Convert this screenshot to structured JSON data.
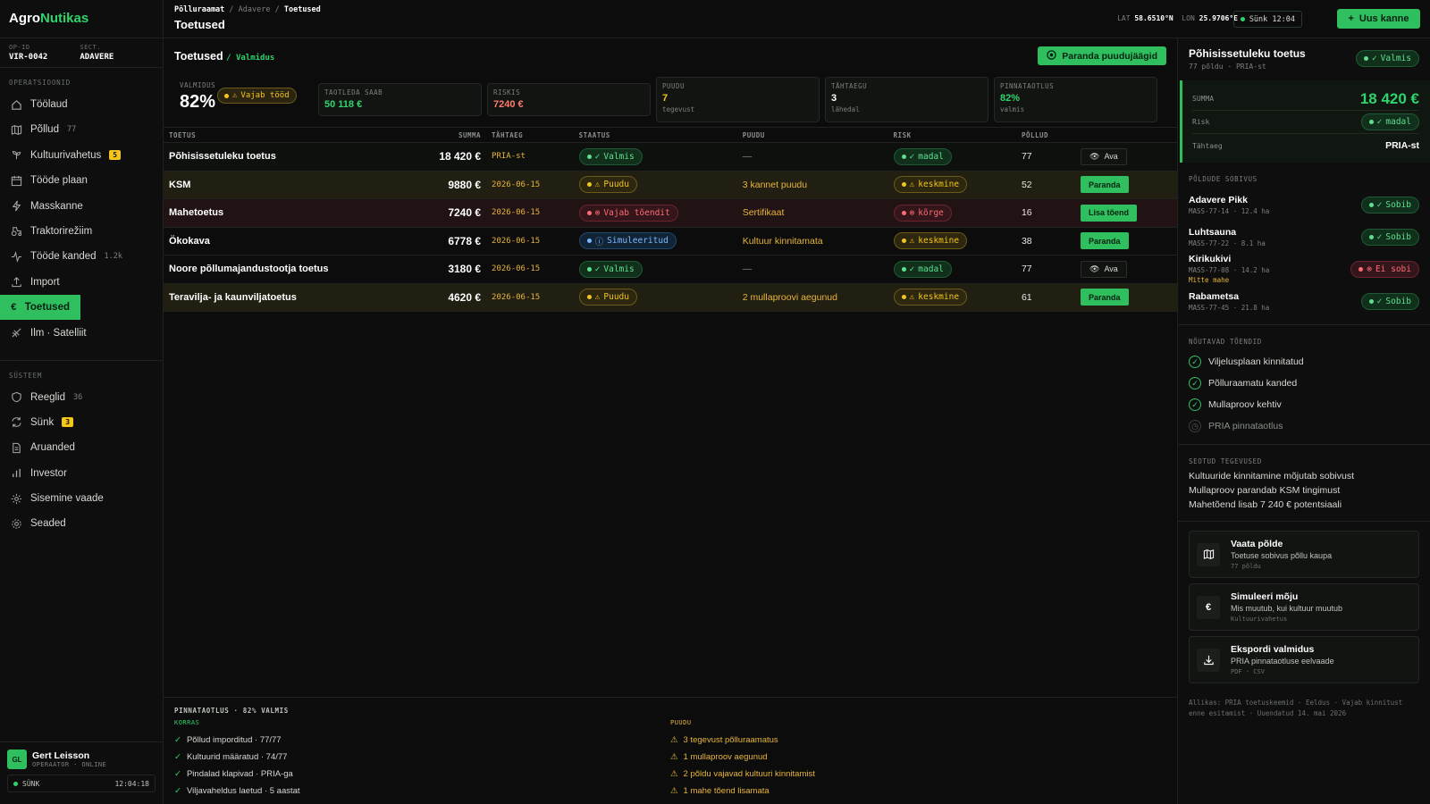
{
  "brand": {
    "part1": "Agro",
    "part2": "Nutikas"
  },
  "op": {
    "id_label": "OP-ID",
    "id_value": "VIR-0042",
    "sect_label": "SECT.",
    "sect_value": "ADAVERE"
  },
  "sidebar": {
    "section1": "OPERATSIOONID",
    "items1": [
      {
        "label": "Töölaud",
        "icon": "home-icon"
      },
      {
        "label": "Põllud",
        "count": "77",
        "icon": "map-icon"
      },
      {
        "label": "Kultuurivahetus",
        "badge": "5",
        "icon": "sprout-icon"
      },
      {
        "label": "Tööde plaan",
        "icon": "calendar-icon"
      },
      {
        "label": "Masskanne",
        "icon": "bolt-icon"
      },
      {
        "label": "Traktorirežiim",
        "icon": "tractor-icon"
      },
      {
        "label": "Tööde kanded",
        "count": "1.2k",
        "icon": "activity-icon"
      },
      {
        "label": "Import",
        "icon": "upload-icon"
      },
      {
        "label": "Toetused",
        "icon": "euro-icon",
        "active": true
      },
      {
        "label": "Ilm · Satelliit",
        "icon": "satellite-icon"
      }
    ],
    "section2": "SÜSTEEM",
    "items2": [
      {
        "label": "Reeglid",
        "count": "36",
        "icon": "shield-icon"
      },
      {
        "label": "Sünk",
        "badge": "3",
        "icon": "sync-icon"
      },
      {
        "label": "Aruanded",
        "icon": "document-icon"
      },
      {
        "label": "Investor",
        "icon": "bar-chart-icon"
      },
      {
        "label": "Sisemine vaade",
        "icon": "cog-icon"
      },
      {
        "label": "Seaded",
        "icon": "gear-icon"
      }
    ]
  },
  "user": {
    "initials": "GL",
    "name": "Gert Leisson",
    "role": "OPERAATOR · ONLINE",
    "sync_label": "SÜNK",
    "sync_time": "12:04:18"
  },
  "topbar": {
    "crumbs": [
      "Põlluraamat",
      "Adavere",
      "Toetused"
    ],
    "title": "Toetused",
    "lat_label": "LAT",
    "lat": "58.6510°N",
    "lon_label": "LON",
    "lon": "25.9706°E",
    "sync": "Sünk 12:04",
    "new_button": "Uus kanne"
  },
  "main": {
    "title": "Toetused",
    "subtitle": "/ Valmidus",
    "fix_button": "Paranda puudujäägid",
    "stats": {
      "readiness_label": "VALMIDUS",
      "readiness_value": "82%",
      "readiness_pill": "Vajab tööd",
      "apply_label": "TAOTLEDA SAAB",
      "apply_value": "50 118 €",
      "risk_label": "RISKIS",
      "risk_value": "7240 €",
      "missing_label": "PUUDU",
      "missing_value": "7",
      "missing_sub": "tegevust",
      "deadline_label": "TÄHTAEGU",
      "deadline_value": "3",
      "deadline_sub": "lähedal",
      "area_label": "PINNATAOTLUS",
      "area_value": "82%",
      "area_sub": "valmis"
    },
    "columns": [
      "TOETUS",
      "SUMMA",
      "TÄHTAEG",
      "STAATUS",
      "PUUDU",
      "RISK",
      "PÕLLUD",
      ""
    ],
    "rows": [
      {
        "name": "Põhisissetuleku toetus",
        "sum": "18 420 €",
        "deadline": "PRIA-st",
        "status": "Valmis",
        "status_type": "g",
        "missing": "—",
        "risk": "madal",
        "risk_type": "g",
        "fields": "77",
        "action": "Ava",
        "action_type": "o",
        "row": "nm"
      },
      {
        "name": "KSM",
        "sum": "9880 €",
        "deadline": "2026-06-15",
        "status": "Puudu",
        "status_type": "y",
        "missing": "3 kannet puudu",
        "risk": "keskmine",
        "risk_type": "y",
        "fields": "52",
        "action": "Paranda",
        "action_type": "g",
        "row": "hl"
      },
      {
        "name": "Mahetoetus",
        "sum": "7240 €",
        "deadline": "2026-06-15",
        "status": "Vajab tõendit",
        "status_type": "r",
        "missing": "Sertifikaat",
        "risk": "kõrge",
        "risk_type": "r",
        "fields": "16",
        "action": "Lisa tõend",
        "action_type": "g",
        "row": "rd"
      },
      {
        "name": "Ökokava",
        "sum": "6778 €",
        "deadline": "2026-06-15",
        "status": "Simuleeritud",
        "status_type": "b",
        "missing": "Kultuur kinnitamata",
        "risk": "keskmine",
        "risk_type": "y",
        "fields": "38",
        "action": "Paranda",
        "action_type": "g",
        "row": ""
      },
      {
        "name": "Noore põllumajandustootja toetus",
        "sum": "3180 €",
        "deadline": "2026-06-15",
        "status": "Valmis",
        "status_type": "g",
        "missing": "—",
        "risk": "madal",
        "risk_type": "g",
        "fields": "77",
        "action": "Ava",
        "action_type": "o",
        "row": ""
      },
      {
        "name": "Teravilja- ja kaunviljatoetus",
        "sum": "4620 €",
        "deadline": "2026-06-15",
        "status": "Puudu",
        "status_type": "y",
        "missing": "2 mullaproovi aegunud",
        "risk": "keskmine",
        "risk_type": "y",
        "fields": "61",
        "action": "Paranda",
        "action_type": "g",
        "row": "hl"
      }
    ],
    "checklist": {
      "title": "PINNATAOTLUS · 82% VALMIS",
      "ok_label": "KORRAS",
      "ok": [
        "Põllud imporditud · 77/77",
        "Kultuurid määratud · 74/77",
        "Pindalad klapivad · PRIA-ga",
        "Viljavaheldus laetud · 5 aastat"
      ],
      "missing_label": "PUUDU",
      "missing": [
        "3 tegevust põlluraamatus",
        "1 mullaproov aegunud",
        "2 põldu vajavad kultuuri kinnitamist",
        "1 mahe tõend lisamata"
      ]
    }
  },
  "panel": {
    "title": "Põhisissetuleku toetus",
    "sub": "77 põldu · PRIA-st",
    "status": "Valmis",
    "sum_label": "SUMMA",
    "sum_value": "18 420 €",
    "risk_label": "Risk",
    "risk_value": "madal",
    "deadline_label": "Tähtaeg",
    "deadline_value": "PRIA-st",
    "fit_title": "PÕLDUDE SOBIVUS",
    "fields": [
      {
        "name": "Adavere Pikk",
        "code": "MASS-77-14 · 12.4 ha",
        "status": "Sobib",
        "type": "g"
      },
      {
        "name": "Luhtsauna",
        "code": "MASS-77-22 · 8.1 ha",
        "status": "Sobib",
        "type": "g"
      },
      {
        "name": "Kirikukivi",
        "code": "MASS-77-08 · 14.2 ha",
        "note": "Mitte mahe",
        "status": "Ei sobi",
        "type": "r"
      },
      {
        "name": "Rabametsa",
        "code": "MASS-77-45 · 21.8 ha",
        "status": "Sobib",
        "type": "g"
      }
    ],
    "evidence_title": "NÕUTAVAD TÕENDID",
    "evidence": [
      {
        "label": "Viljelusplaan kinnitatud",
        "done": true
      },
      {
        "label": "Põlluraamatu kanded",
        "done": true
      },
      {
        "label": "Mullaproov kehtiv",
        "done": true
      },
      {
        "label": "PRIA pinnataotlus",
        "done": false
      }
    ],
    "related_title": "SEOTUD TEGEVUSED",
    "related": [
      "Kultuuride kinnitamine mõjutab sobivust",
      "Mullaproov parandab KSM tingimust",
      "Mahetõend lisab 7 240 € potentsiaali"
    ],
    "cards": [
      {
        "title": "Vaata põlde",
        "desc": "Toetuse sobivus põllu kaupa",
        "meta": "77 põldu",
        "icon": "map-icon"
      },
      {
        "title": "Simuleeri mõju",
        "desc": "Mis muutub, kui kultuur muutub",
        "meta": "Kultuurivahetus",
        "icon": "euro-icon"
      },
      {
        "title": "Ekspordi valmidus",
        "desc": "PRIA pinnataotluse eelvaade",
        "meta": "PDF · CSV",
        "icon": "download-icon"
      }
    ],
    "note": "Allikas: PRIA toetuskeemid · Eeldus · Vajab kinnitust enne esitamist · Uuendatud 14. mai 2026"
  }
}
